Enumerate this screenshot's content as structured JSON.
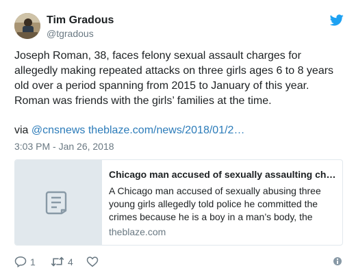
{
  "author": {
    "name": "Tim Gradous",
    "handle": "@tgradous"
  },
  "tweet": {
    "text": "Joseph Roman, 38, faces felony sexual assault charges for allegedly making repeated attacks on three girls ages 6 to 8 years old over a period spanning from 2015 to January of this year. Roman was friends with the girls’ families at the time.",
    "via_label": "via",
    "mention": "@cnsnews",
    "url": "theblaze.com/news/2018/01/2…",
    "timestamp": "3:03 PM - Jan 26, 2018"
  },
  "card": {
    "title": "Chicago man accused of sexually assaulting ch…",
    "description": "A Chicago man accused of sexually abusing three young girls allegedly told police he committed the crimes because he is a boy in a man’s body, the",
    "domain": "theblaze.com"
  },
  "actions": {
    "reply_count": "1",
    "retweet_count": "4"
  },
  "icons": {
    "brand": "twitter-bird-icon",
    "card_placeholder": "document-icon",
    "reply": "reply-icon",
    "retweet": "retweet-icon",
    "like": "heart-icon",
    "info": "info-icon"
  },
  "colors": {
    "twitter_blue": "#1da1f2",
    "link": "#2b7bb9",
    "secondary_text": "#697882",
    "border": "#e1e8ed"
  }
}
